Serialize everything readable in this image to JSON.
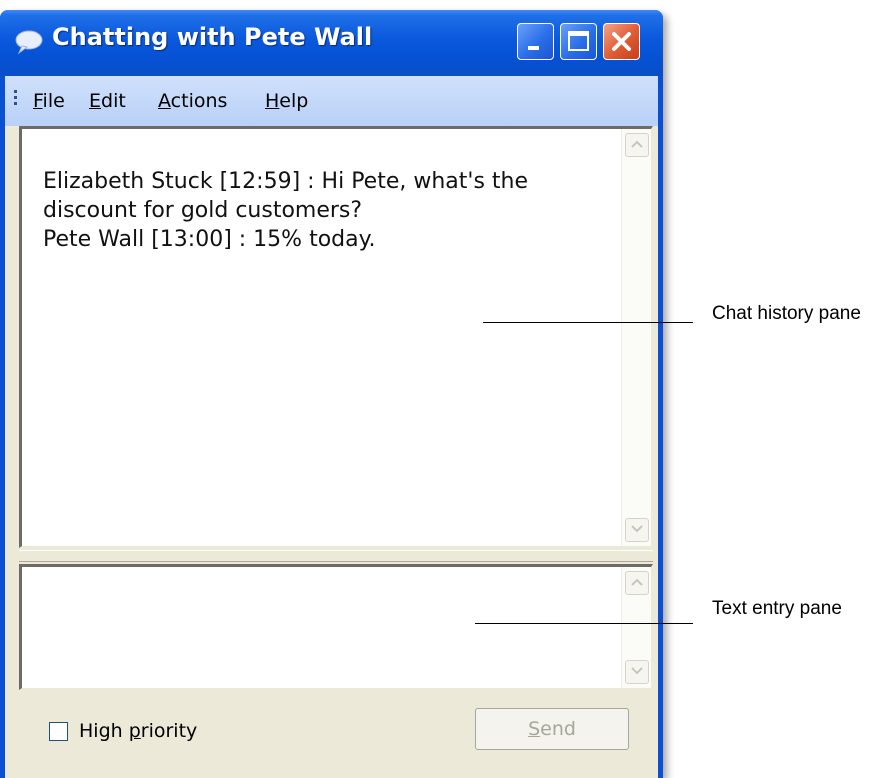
{
  "window": {
    "title": "Chatting with Pete Wall",
    "title_icon": "chat-bubble-icon",
    "controls": [
      "minimize",
      "maximize",
      "close"
    ]
  },
  "menu": {
    "items": [
      {
        "label": "File",
        "accel": "F",
        "rest": "ile"
      },
      {
        "label": "Edit",
        "accel": "E",
        "rest": "dit"
      },
      {
        "label": "Actions",
        "accel": "A",
        "rest": "ctions"
      },
      {
        "label": "Help",
        "accel": "H",
        "rest": "elp"
      }
    ]
  },
  "history": {
    "lines": [
      "Elizabeth Stuck [12:59] : Hi Pete, what's the",
      "discount for gold customers?",
      "Pete Wall [13:00] : 15% today."
    ]
  },
  "entry": {
    "value": ""
  },
  "footer": {
    "priority_label_pre": "High ",
    "priority_label_accel": "p",
    "priority_label_post": "riority",
    "priority_checked": false,
    "send_accel": "S",
    "send_rest": "end",
    "send_enabled": false
  },
  "callouts": {
    "history": "Chat history pane",
    "entry": "Text entry pane"
  },
  "colors": {
    "titlebar": "#0a58dc",
    "menubar": "#c4d8f8",
    "client": "#ece9d8",
    "close_button": "#e05a32"
  }
}
